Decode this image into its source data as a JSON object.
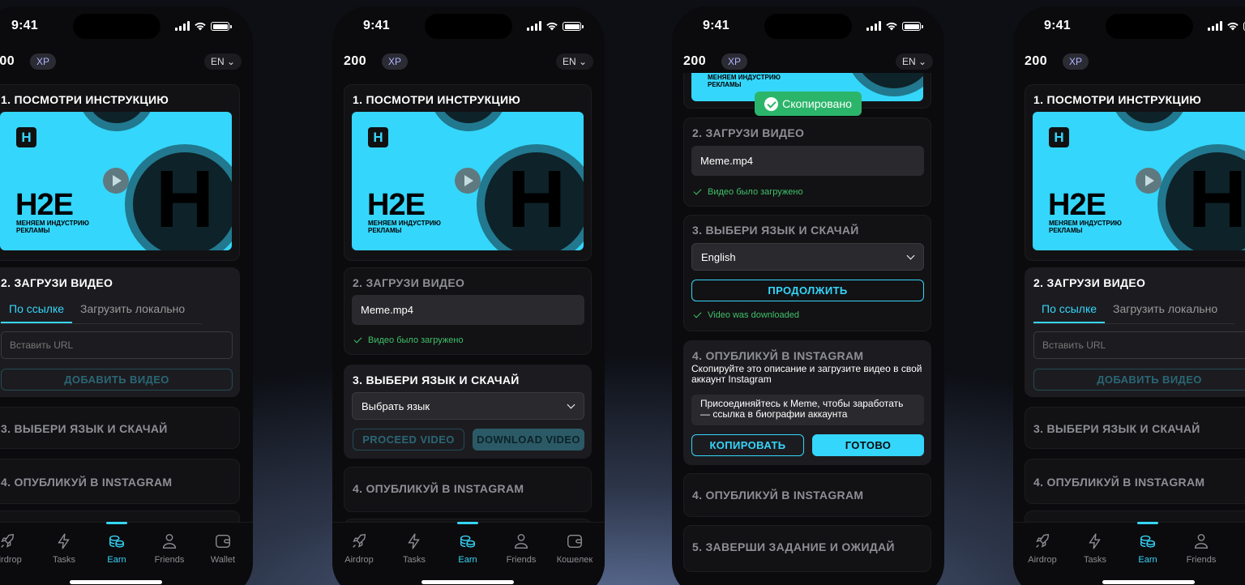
{
  "status": {
    "time": "9:41"
  },
  "header": {
    "xp_value": "200",
    "xp_label": "XP",
    "lang": "EN ⌄"
  },
  "colors": {
    "accent": "#35d6fb",
    "success": "#3fc06a",
    "card": "#121214",
    "card_active": "#1c1c20"
  },
  "thumbnail": {
    "logo": "H",
    "title": "H2E",
    "subtitle": "МЕНЯЕМ ИНДУСТРИЮ РЕКЛАМЫ",
    "coin_letter": "H",
    "partial_subtitle": "МЕНЯЕМ ИНДУСТРИЮ РЕКЛАМЫ"
  },
  "steps": {
    "s1": "1. ПОСМОТРИ ИНСТРУКЦИЮ",
    "s2": "2. ЗАГРУЗИ ВИДЕО",
    "s3": "3. ВЫБЕРИ ЯЗЫК И СКАЧАЙ",
    "s4": "4. ОПУБЛИКУЙ В INSTAGRAM",
    "s5": "5. ЗАВЕРШИ ЗАДАНИЕ И ОЖИДАЙ"
  },
  "upload": {
    "tab_link": "По ссылке",
    "tab_local": "Загрузить локально",
    "url_placeholder": "Вставить URL",
    "add_button": "ДОБАВИТЬ ВИДЕО",
    "file_name": "Meme.mp4",
    "uploaded_note": "Видео было загружено"
  },
  "download": {
    "select_placeholder": "Выбрать язык",
    "selected_lang": "English",
    "proceed_button": "PROCEED VIDEO",
    "download_button": "DOWNLOAD VIDEO",
    "continue_button": "ПРОДОЛЖИТЬ",
    "downloaded_note": "Video was downloaded"
  },
  "publish": {
    "description": "Скопируйте это описание и загрузите видео в свой аккаунт Instagram",
    "caption": "Присоединяйтесь к Meme, чтобы заработать — ссылка в биографии аккаунта",
    "copy_button": "КОПИРОВАТЬ",
    "done_button": "ГОТОВО"
  },
  "toast": {
    "text": "Скопировано"
  },
  "nav": {
    "airdrop": "Airdrop",
    "tasks": "Tasks",
    "earn": "Earn",
    "friends": "Friends",
    "wallet": "Wallet",
    "wallet_ru": "Кошелек",
    "icons": [
      "rocket-icon",
      "lightning-icon",
      "coins-icon",
      "friends-icon",
      "wallet-icon"
    ]
  }
}
